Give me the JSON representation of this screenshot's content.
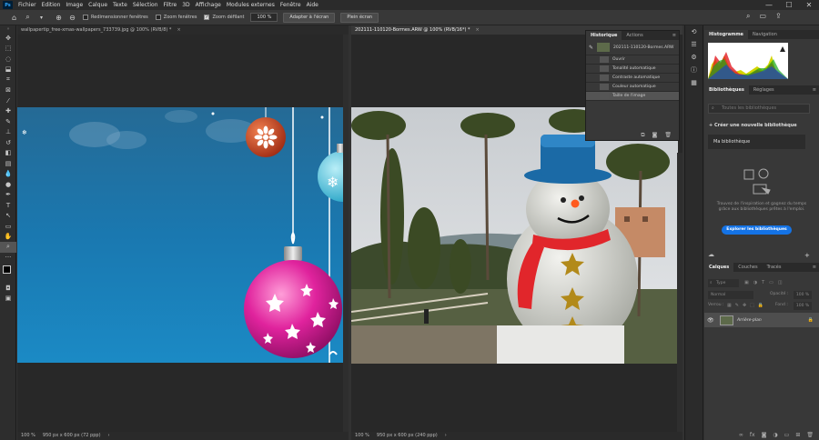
{
  "app": {
    "logo": "Ps"
  },
  "menu": [
    "Fichier",
    "Edition",
    "Image",
    "Calque",
    "Texte",
    "Sélection",
    "Filtre",
    "3D",
    "Affichage",
    "Modules externes",
    "Fenêtre",
    "Aide"
  ],
  "window_controls": {
    "minimize": "—",
    "maximize": "☐",
    "close": "✕"
  },
  "options": {
    "resize_windows": "Redimensionner fenêtres",
    "zoom_all": "Zoom fenêtres",
    "scrubby_zoom": "Zoom défilant",
    "zoom_value": "100 %",
    "fit_screen": "Adapter à l'écran",
    "fill_screen": "Plein écran"
  },
  "tools": [
    "move",
    "artboard",
    "lasso",
    "object-select",
    "crop",
    "frame",
    "eyedropper",
    "healing",
    "brush",
    "stamp",
    "history-brush",
    "eraser",
    "gradient",
    "blur",
    "dodge",
    "pen",
    "type",
    "path-select",
    "rectangle",
    "hand",
    "zoom"
  ],
  "doc_left": {
    "tab": "wallpapertip_free-xmas-wallpapers_733739.jpg @ 100% (RVB/8) *",
    "status_zoom": "100 %",
    "status_info": "950 px x 600 px (72 ppp)"
  },
  "doc_right": {
    "tab": "202111-110120-Bormes.ARW @ 100% (RVB/16*) *",
    "status_zoom": "100 %",
    "status_info": "950 px x 600 px (240 ppp)"
  },
  "history": {
    "tabs": [
      "Historique",
      "Actions"
    ],
    "snapshot": "202111-110120-Bormes.ARW",
    "items": [
      "Ouvrir",
      "Tonalité automatique",
      "Contraste automatique",
      "Couleur automatique",
      "Taille de l'image"
    ]
  },
  "histogram": {
    "tabs": [
      "Histogramme",
      "Navigation"
    ]
  },
  "libraries": {
    "tabs": [
      "Bibliothèques",
      "Réglages"
    ],
    "search_placeholder": "Toutes les bibliothèques",
    "create": "Créer une nouvelle bibliothèque",
    "my_library": "Ma bibliothèque",
    "description": "Trouvez de l'inspiration et gagnez du temps grâce aux bibliothèques prêtes à l'emploi.",
    "explore": "Explorer les bibliothèques"
  },
  "layers": {
    "tabs": [
      "Calques",
      "Couches",
      "Tracés"
    ],
    "filter_label": "Type",
    "blend_mode": "Normal",
    "opacity_label": "Opacité :",
    "opacity_value": "100 %",
    "lock_label": "Verrou :",
    "fill_label": "Fond :",
    "fill_value": "100 %",
    "layer_name": "Arrière-plan"
  },
  "colors": {
    "accent": "#31a8ff",
    "explore_button": "#1473e6",
    "selected_history": "#545454"
  }
}
